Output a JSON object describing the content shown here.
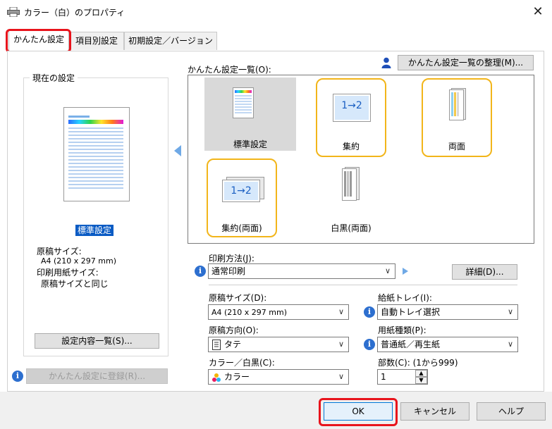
{
  "window": {
    "title": "カラー（白）のプロパティ",
    "close": "✕"
  },
  "tabs": [
    {
      "label": "かんたん設定",
      "active": true
    },
    {
      "label": "項目別設定",
      "active": false
    },
    {
      "label": "初期設定／バージョン",
      "active": false
    }
  ],
  "current_settings": {
    "legend": "現在の設定",
    "preset_name": "標準設定",
    "original_size_label": "原稿サイズ:",
    "original_size_value": "A4 (210 x 297 mm)",
    "paper_size_label": "印刷用紙サイズ:",
    "paper_size_value": "原稿サイズと同じ",
    "summary_button": "設定内容一覧(S)...",
    "register_button": "かんたん設定に登録(R)..."
  },
  "preset_list": {
    "label": "かんたん設定一覧(O):",
    "organize_button": "かんたん設定一覧の整理(M)...",
    "items": [
      {
        "label": "標準設定",
        "icon": "standard-page-icon"
      },
      {
        "label": "集約",
        "icon": "nup-icon",
        "glyph": "1→2"
      },
      {
        "label": "両面",
        "icon": "duplex-icon"
      },
      {
        "label": "集約(両面)",
        "icon": "nup-duplex-icon",
        "glyph": "1→2"
      },
      {
        "label": "白黒(両面)",
        "icon": "mono-duplex-icon"
      }
    ]
  },
  "print_method": {
    "label": "印刷方法(J):",
    "value": "通常印刷",
    "details_button": "詳細(D)..."
  },
  "fields": {
    "original_size": {
      "label": "原稿サイズ(D):",
      "value": "A4 (210 x 297 mm)"
    },
    "paper_tray": {
      "label": "給紙トレイ(I):",
      "value": "自動トレイ選択"
    },
    "orientation": {
      "label": "原稿方向(O):",
      "value": "タテ"
    },
    "paper_type": {
      "label": "用紙種類(P):",
      "value": "普通紙／再生紙"
    },
    "color_mode": {
      "label": "カラー／白黒(C):",
      "value": "カラー"
    },
    "copies": {
      "label": "部数(C): (1から999)",
      "value": "1"
    }
  },
  "footer": {
    "ok": "OK",
    "cancel": "キャンセル",
    "help": "ヘルプ"
  },
  "colors": {
    "highlight_red": "#e8141c",
    "tile_highlight": "#f2b51a",
    "info_blue": "#2d6fcf",
    "selection_blue": "#0a5bc4"
  }
}
